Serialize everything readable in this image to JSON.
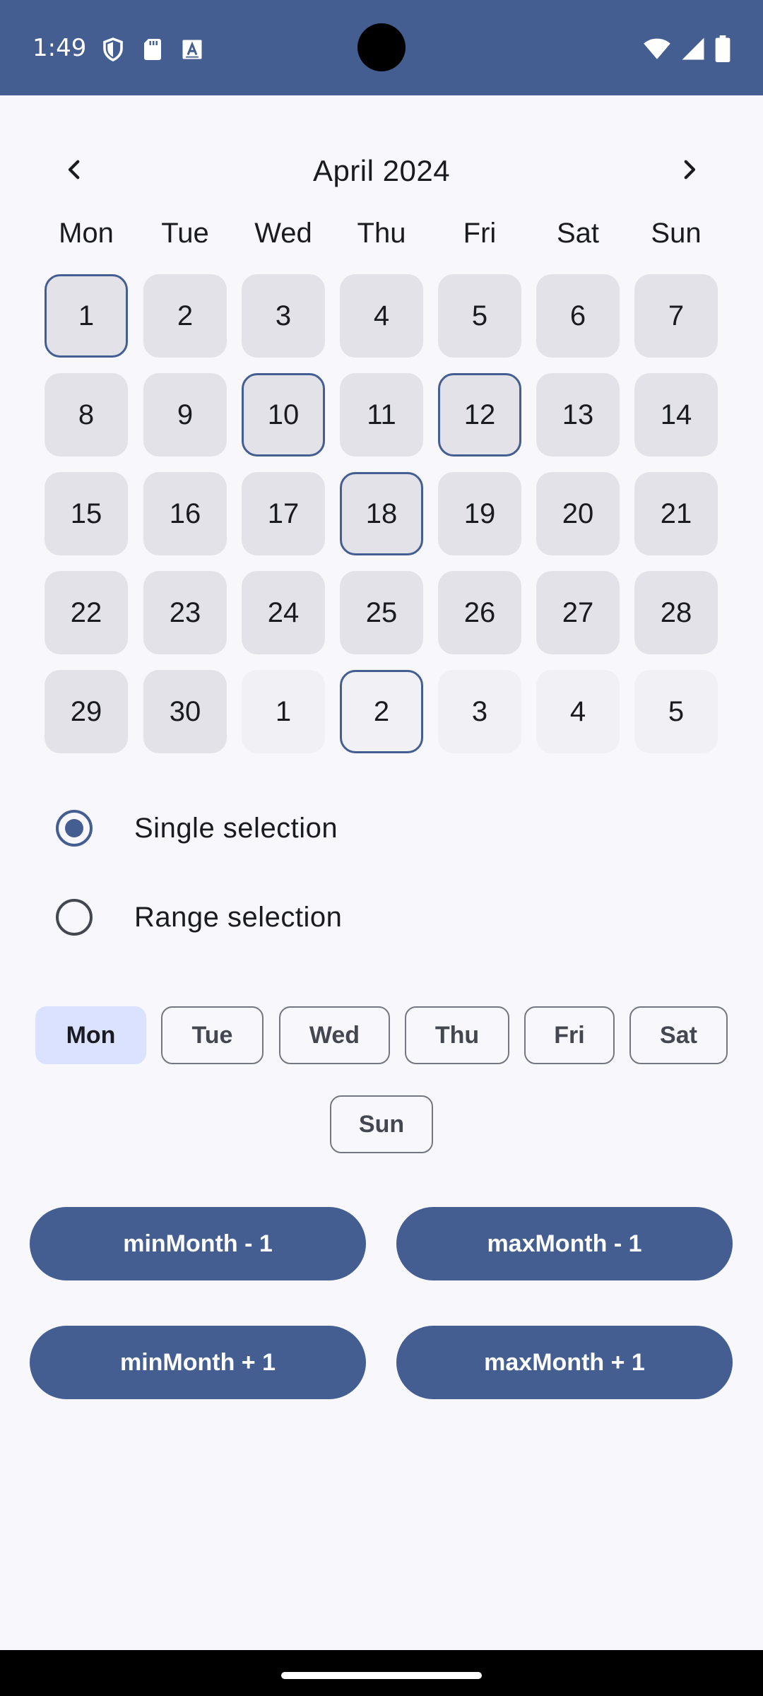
{
  "status_bar": {
    "time": "1:49",
    "icons_left": [
      "shield-icon",
      "sd-card-icon",
      "text-a-icon"
    ],
    "icons_right": [
      "wifi-icon",
      "signal-icon",
      "battery-icon"
    ],
    "background": "#455e91"
  },
  "calendar": {
    "month_title": "April 2024",
    "prev_icon": "chevron-left-icon",
    "next_icon": "chevron-right-icon",
    "weekdays": [
      "Mon",
      "Tue",
      "Wed",
      "Thu",
      "Fri",
      "Sat",
      "Sun"
    ],
    "weeks": [
      [
        {
          "label": "1",
          "marked": true
        },
        {
          "label": "2"
        },
        {
          "label": "3"
        },
        {
          "label": "4"
        },
        {
          "label": "5"
        },
        {
          "label": "6"
        },
        {
          "label": "7"
        }
      ],
      [
        {
          "label": "8"
        },
        {
          "label": "9"
        },
        {
          "label": "10",
          "marked": true
        },
        {
          "label": "11"
        },
        {
          "label": "12",
          "marked": true
        },
        {
          "label": "13"
        },
        {
          "label": "14"
        }
      ],
      [
        {
          "label": "15"
        },
        {
          "label": "16"
        },
        {
          "label": "17"
        },
        {
          "label": "18",
          "marked": true
        },
        {
          "label": "19"
        },
        {
          "label": "20"
        },
        {
          "label": "21"
        }
      ],
      [
        {
          "label": "22"
        },
        {
          "label": "23"
        },
        {
          "label": "24"
        },
        {
          "label": "25"
        },
        {
          "label": "26"
        },
        {
          "label": "27"
        },
        {
          "label": "28"
        }
      ],
      [
        {
          "label": "29"
        },
        {
          "label": "30"
        },
        {
          "label": "1",
          "outside": true
        },
        {
          "label": "2",
          "outside": true,
          "marked": true
        },
        {
          "label": "3",
          "outside": true
        },
        {
          "label": "4",
          "outside": true
        },
        {
          "label": "5",
          "outside": true
        }
      ]
    ]
  },
  "selection_mode": {
    "options": [
      {
        "label": "Single selection",
        "checked": true
      },
      {
        "label": "Range selection",
        "checked": false
      }
    ]
  },
  "first_day_chips": [
    {
      "label": "Mon",
      "selected": true
    },
    {
      "label": "Tue",
      "selected": false
    },
    {
      "label": "Wed",
      "selected": false
    },
    {
      "label": "Thu",
      "selected": false
    },
    {
      "label": "Fri",
      "selected": false
    },
    {
      "label": "Sat",
      "selected": false
    },
    {
      "label": "Sun",
      "selected": false
    }
  ],
  "buttons": {
    "min_month_minus": "minMonth - 1",
    "max_month_minus": "maxMonth - 1",
    "min_month_plus": "minMonth + 1",
    "max_month_plus": "maxMonth + 1"
  },
  "colors": {
    "primary": "#455e91",
    "cell": "#e2e2e8",
    "cell_outside": "#f1f0f5",
    "chip_selected": "#dae2ff",
    "background": "#f8f8fc"
  }
}
